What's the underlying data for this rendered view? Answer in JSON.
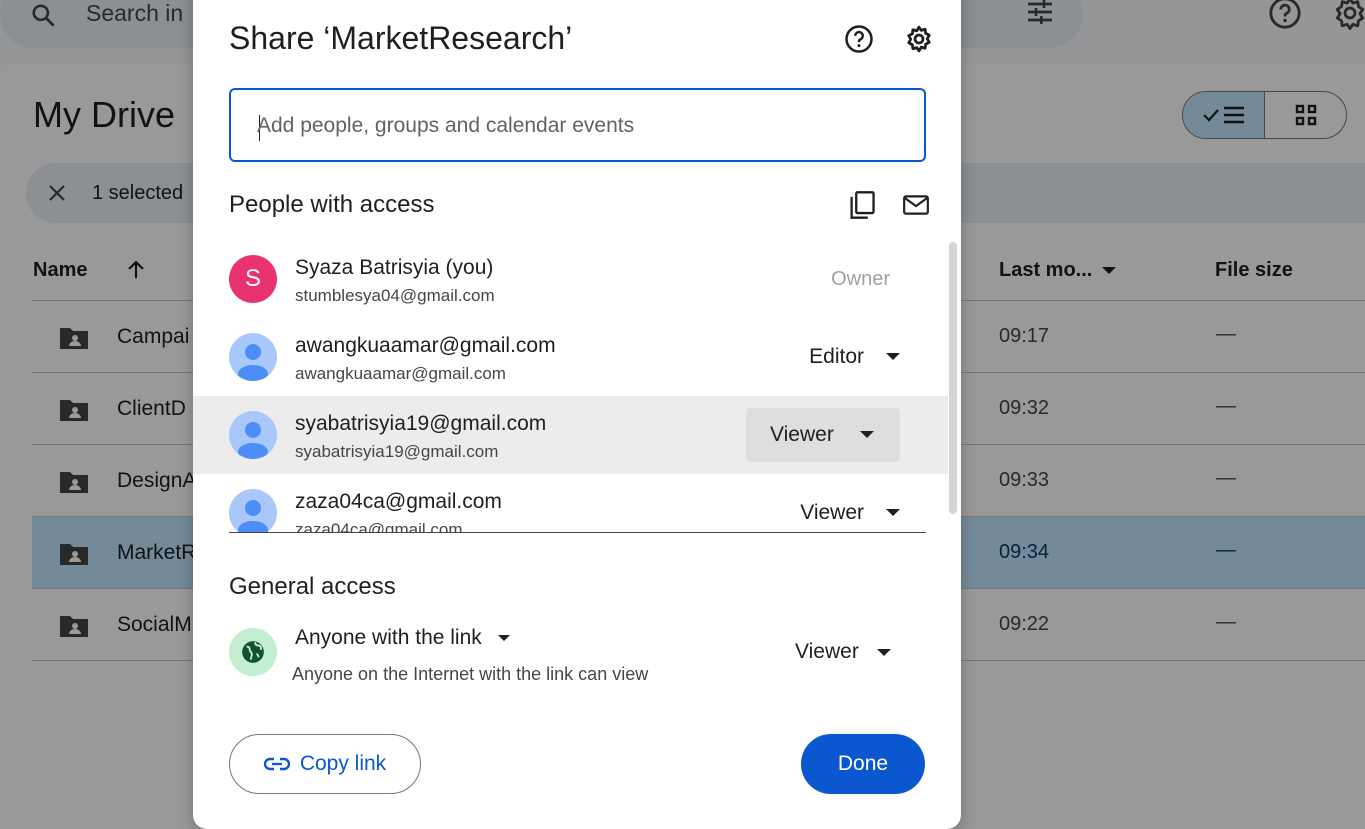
{
  "search": {
    "placeholder": "Search in"
  },
  "drive": {
    "title": "My Drive",
    "selection_text": "1 selected",
    "columns": {
      "name": "Name",
      "last_modified": "Last mo...",
      "file_size": "File size"
    },
    "rows": [
      {
        "name": "Campai",
        "time": "09:17",
        "size": "—",
        "selected": false
      },
      {
        "name": "ClientD",
        "time": "09:32",
        "size": "—",
        "selected": false
      },
      {
        "name": "DesignA",
        "time": "09:33",
        "size": "—",
        "selected": false
      },
      {
        "name": "MarketR",
        "time": "09:34",
        "size": "—",
        "selected": true
      },
      {
        "name": "SocialM",
        "time": "09:22",
        "size": "—",
        "selected": false
      }
    ]
  },
  "dialog": {
    "title": "Share ‘MarketResearch’",
    "add_placeholder": "Add people, groups and calendar events",
    "people_heading": "People with access",
    "people": [
      {
        "name": "Syaza Batrisyia (you)",
        "email": "stumblesya04@gmail.com",
        "role": "Owner",
        "avatar_letter": "S",
        "avatar_color": "#e8336e"
      },
      {
        "name": "awangkuaamar@gmail.com",
        "email": "awangkuaamar@gmail.com",
        "role": "Editor"
      },
      {
        "name": "syabatrisyia19@gmail.com",
        "email": "syabatrisyia19@gmail.com",
        "role": "Viewer"
      },
      {
        "name": "zaza04ca@gmail.com",
        "email": "zaza04ca@gmail.com",
        "role": "Viewer"
      }
    ],
    "general_heading": "General access",
    "general_access": {
      "type": "Anyone with the link",
      "description": "Anyone on the Internet with the link can view",
      "role": "Viewer",
      "icon": "globe-icon",
      "icon_bg": "#c4eed0"
    },
    "copy_link_label": "Copy link",
    "done_label": "Done"
  },
  "colors": {
    "accent": "#0b57d0",
    "selected_row": "#c2e7ff"
  }
}
